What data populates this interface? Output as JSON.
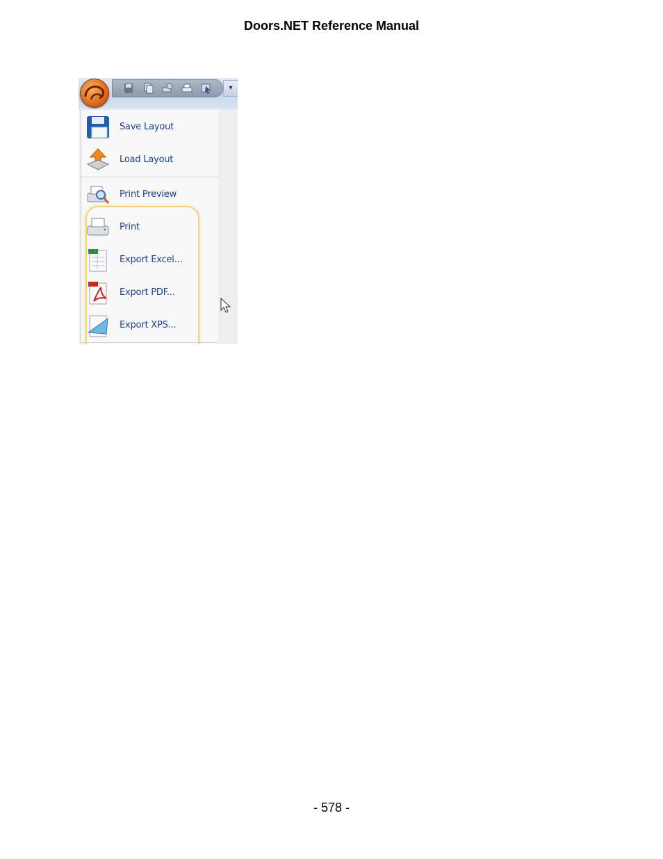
{
  "header": {
    "title": "Doors.NET Reference Manual"
  },
  "footer": {
    "page_number": "- 578 -"
  },
  "app_menu": {
    "items": [
      {
        "label": "Save Layout",
        "icon": "save-icon"
      },
      {
        "label": "Load Layout",
        "icon": "load-icon"
      },
      {
        "label": "Print Preview",
        "icon": "print-preview-icon"
      },
      {
        "label": "Print",
        "icon": "printer-icon"
      },
      {
        "label": "Export Excel...",
        "icon": "excel-icon"
      },
      {
        "label": "Export PDF...",
        "icon": "pdf-icon"
      },
      {
        "label": "Export XPS...",
        "icon": "xps-icon"
      }
    ],
    "highlight_color": "#f4d27b",
    "label_color": "#1e3f86"
  }
}
